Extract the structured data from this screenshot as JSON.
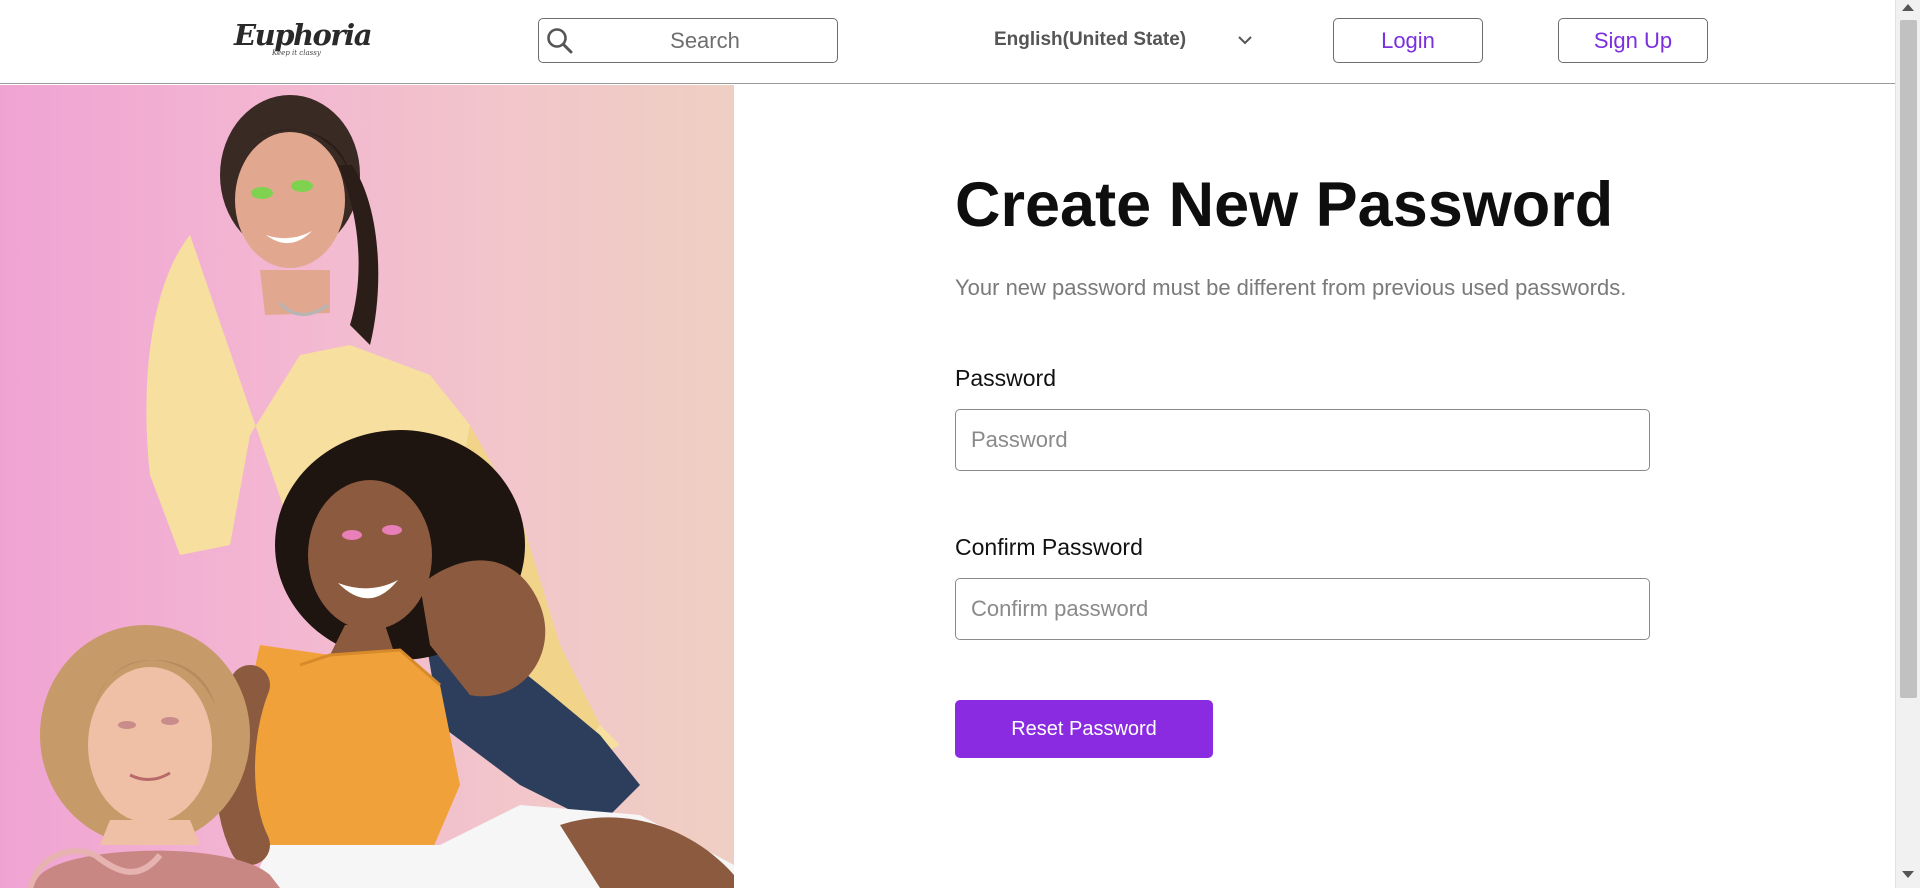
{
  "header": {
    "logo_text": "Euphoria",
    "logo_tagline": "Keep it classy",
    "search_placeholder": "Search",
    "language": "English(United State)",
    "login_label": "Login",
    "signup_label": "Sign Up"
  },
  "main": {
    "title": "Create New Password",
    "subtitle": "Your new password must be different from previous used passwords.",
    "password_label": "Password",
    "password_placeholder": "Password",
    "password_value": "",
    "confirm_label": "Confirm Password",
    "confirm_placeholder": "Confirm password",
    "confirm_value": "",
    "reset_label": "Reset Password"
  },
  "colors": {
    "accent": "#8a2be2",
    "accent_text": "#7b2fe0",
    "hero_pink": "#f0a3d3",
    "hero_peach": "#efcfc3"
  },
  "icons": {
    "search": "search-icon",
    "chevron": "chevron-down-icon",
    "scroll_up": "scroll-up-arrow-icon",
    "scroll_down": "scroll-down-arrow-icon"
  }
}
